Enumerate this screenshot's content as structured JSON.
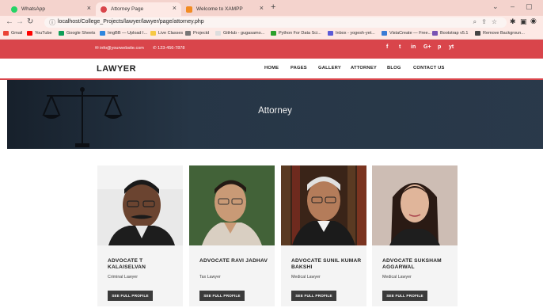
{
  "browser": {
    "tabs": [
      {
        "title": "WhatsApp",
        "favicon_color": "#25d366",
        "active": false
      },
      {
        "title": "Attorney Page",
        "favicon_color": "#d9454b",
        "active": true
      },
      {
        "title": "Welcome to XAMPP",
        "favicon_color": "#f28b22",
        "active": false
      }
    ],
    "new_tab": "+",
    "address": "localhost/College_Projects/lawyer/lawyer/page/attorney.php",
    "bookmarks": [
      {
        "label": "Gmail",
        "color": "#ea4335"
      },
      {
        "label": "YouTube",
        "color": "#ff0000"
      },
      {
        "label": "Google Sheets",
        "color": "#0f9d58"
      },
      {
        "label": "ImgBB — Upload I...",
        "color": "#2e86de"
      },
      {
        "label": "Live Classes",
        "color": "#f6c945"
      },
      {
        "label": "Projectd",
        "color": "#777777"
      },
      {
        "label": "GitHub - gugasamo...",
        "color": "#dddddd"
      },
      {
        "label": "Python For Data Sci...",
        "color": "#2ca02c"
      },
      {
        "label": "Inbox - yogesh-yet...",
        "color": "#5b5bd6"
      },
      {
        "label": "VistaCreate — Free...",
        "color": "#3a7bd5"
      },
      {
        "label": "Bootstrap v5.1",
        "color": "#7952b3"
      },
      {
        "label": "Remove Backgroun...",
        "color": "#444444"
      }
    ]
  },
  "topbar": {
    "email": "info@yourwebsite.com",
    "phone": "123-456-7878",
    "social": [
      "f",
      "t",
      "in",
      "G+",
      "p",
      "yt"
    ]
  },
  "header": {
    "logo": "LAWYER",
    "menu": [
      "HOME",
      "PAGES",
      "GALLERY",
      "ATTORNEY",
      "BLOG",
      "CONTACT US"
    ]
  },
  "hero": {
    "title": "Attorney"
  },
  "attorneys": [
    {
      "name": "ADVOCATE T KALAISELVAN",
      "role": "Criminal Lawyer",
      "button": "SEE FULL PROFILE"
    },
    {
      "name": "ADVOCATE RAVI JADHAV",
      "role": "Tax Lawyer",
      "button": "SEE FULL PROFILE"
    },
    {
      "name": "ADVOCATE SUNIL KUMAR BAKSHI",
      "role": "Medical Lawyer",
      "button": "SEE FULL PROFILE"
    },
    {
      "name": "ADVOCATE SUKSHAM AGGARWAL",
      "role": "Medical Lawyer",
      "button": "SEE FULL PROFILE"
    }
  ],
  "colors": {
    "accent": "#d9454b",
    "hero": "#2b3b4c",
    "button": "#3b3b3b"
  }
}
